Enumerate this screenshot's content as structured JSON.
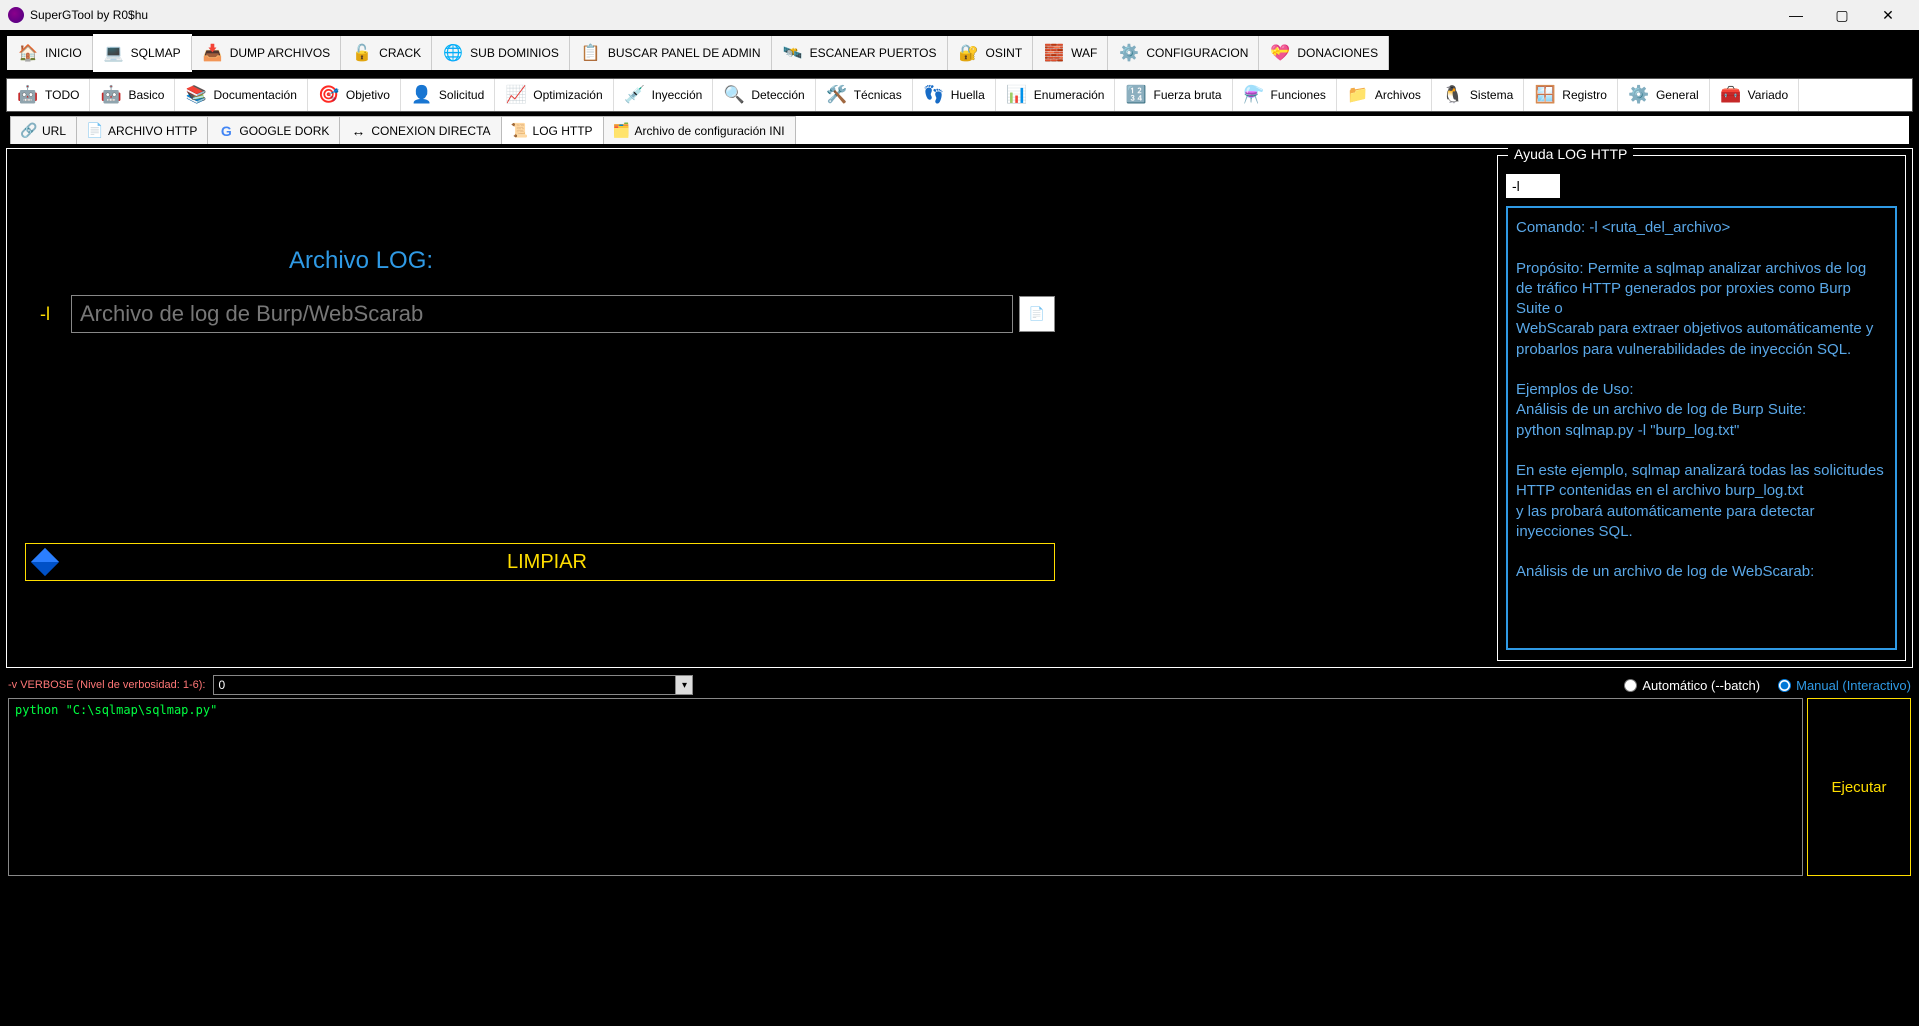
{
  "window": {
    "title": "SuperGTool by R0$hu"
  },
  "main_tabs": [
    {
      "label": "INICIO",
      "icon": "🏠",
      "active": false
    },
    {
      "label": "SQLMAP",
      "icon": "💻",
      "active": true
    },
    {
      "label": "DUMP ARCHIVOS",
      "icon": "📥",
      "active": false
    },
    {
      "label": "CRACK",
      "icon": "🔓",
      "active": false
    },
    {
      "label": "SUB DOMINIOS",
      "icon": "🌐",
      "active": false
    },
    {
      "label": "BUSCAR PANEL DE ADMIN",
      "icon": "📋",
      "active": false
    },
    {
      "label": "ESCANEAR PUERTOS",
      "icon": "🛰️",
      "active": false
    },
    {
      "label": "OSINT",
      "icon": "🔐",
      "active": false
    },
    {
      "label": "WAF",
      "icon": "🧱",
      "active": false
    },
    {
      "label": "CONFIGURACION",
      "icon": "⚙️",
      "active": false
    },
    {
      "label": "DONACIONES",
      "icon": "💝",
      "active": false
    }
  ],
  "sub_tabs": [
    {
      "label": "TODO",
      "icon": "🤖"
    },
    {
      "label": "Basico",
      "icon": "🤖"
    },
    {
      "label": "Documentación",
      "icon": "📚"
    },
    {
      "label": "Objetivo",
      "icon": "🎯"
    },
    {
      "label": "Solicitud",
      "icon": "👤"
    },
    {
      "label": "Optimización",
      "icon": "📈"
    },
    {
      "label": "Inyección",
      "icon": "💉"
    },
    {
      "label": "Detección",
      "icon": "🔍"
    },
    {
      "label": "Técnicas",
      "icon": "🛠️"
    },
    {
      "label": "Huella",
      "icon": "👣"
    },
    {
      "label": "Enumeración",
      "icon": "📊"
    },
    {
      "label": "Fuerza bruta",
      "icon": "🔢"
    },
    {
      "label": "Funciones",
      "icon": "⚗️"
    },
    {
      "label": "Archivos",
      "icon": "📁"
    },
    {
      "label": "Sistema",
      "icon": "🐧"
    },
    {
      "label": "Registro",
      "icon": "🪟"
    },
    {
      "label": "General",
      "icon": "⚙️"
    },
    {
      "label": "Variado",
      "icon": "🧰"
    }
  ],
  "target_tabs": [
    {
      "label": "URL",
      "icon": "🔗",
      "active": false
    },
    {
      "label": "ARCHIVO HTTP",
      "icon": "📄",
      "active": false
    },
    {
      "label": "GOOGLE DORK",
      "icon": "G",
      "active": false
    },
    {
      "label": "CONEXION DIRECTA",
      "icon": "↔",
      "active": false
    },
    {
      "label": "LOG HTTP",
      "icon": "📜",
      "active": true
    },
    {
      "label": "Archivo de configuración INI",
      "icon": "🗂️",
      "active": false
    }
  ],
  "log_section": {
    "title": "Archivo LOG:",
    "flag": "-l",
    "placeholder": "Archivo de log de Burp/WebScarab",
    "clear_label": "LIMPIAR"
  },
  "help": {
    "legend": "Ayuda LOG HTTP",
    "flag_display": "-l",
    "body": "Comando: -l <ruta_del_archivo>\n\nPropósito: Permite a sqlmap analizar archivos de log de tráfico HTTP generados por proxies como Burp Suite o\nWebScarab para extraer objetivos automáticamente y probarlos para vulnerabilidades de inyección SQL.\n\nEjemplos de Uso:\nAnálisis de un archivo de log de Burp Suite:\npython sqlmap.py -l \"burp_log.txt\"\n\nEn este ejemplo, sqlmap analizará todas las solicitudes HTTP contenidas en el archivo burp_log.txt\ny las probará automáticamente para detectar inyecciones SQL.\n\nAnálisis de un archivo de log de WebScarab:"
  },
  "verbose": {
    "label": "-v VERBOSE (Nivel de verbosidad: 1-6):",
    "value": "0"
  },
  "mode": {
    "auto_label": "Automático (--batch)",
    "manual_label": "Manual (Interactivo)",
    "selected": "manual"
  },
  "console": {
    "command": "python \"C:\\sqlmap\\sqlmap.py\""
  },
  "execute_label": "Ejecutar"
}
